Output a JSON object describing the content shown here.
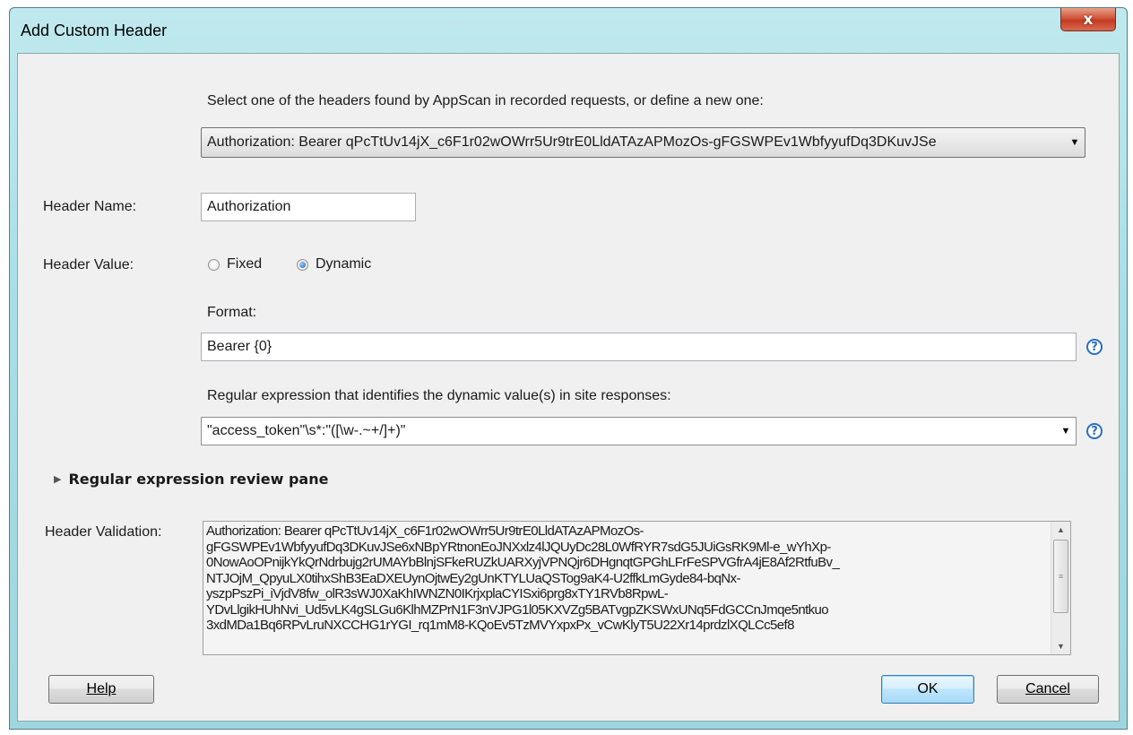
{
  "window": {
    "title": "Add Custom Header",
    "close_glyph": "x",
    "icons": {
      "close": "close-icon",
      "help": "question-mark-icon",
      "expander": "triangle-right-icon",
      "dropdown": "chevron-down-icon"
    }
  },
  "intro": "Select one of the headers found by AppScan in recorded requests, or define a new one:",
  "header_select": {
    "value": "Authorization: Bearer qPcTtUv14jX_c6F1r02wOWrr5Ur9trE0LldATAzAPMozOs-gFGSWPEv1WbfyyufDq3DKuvJSe",
    "arrow": "▼"
  },
  "header_name": {
    "label": "Header Name:",
    "value": "Authorization"
  },
  "header_value": {
    "label": "Header Value:",
    "options": [
      {
        "label": "Fixed",
        "selected": false
      },
      {
        "label": "Dynamic",
        "selected": true
      }
    ]
  },
  "format": {
    "label": "Format:",
    "value": "Bearer {0}"
  },
  "regex": {
    "label": "Regular expression that identifies the dynamic value(s) in site responses:",
    "value": "\"access_token\"\\s*:\"([\\w-.~+/]+)\"",
    "arrow": "▼"
  },
  "review_pane": {
    "label": "Regular expression review pane",
    "glyph": "▶"
  },
  "validation": {
    "label": "Header Validation:",
    "lines": [
      "Authorization: Bearer qPcTtUv14jX_c6F1r02wOWrr5Ur9trE0LldATAzAPMozOs-",
      "gFGSWPEv1WbfyyufDq3DKuvJSe6xNBpYRtnonEoJNXxlz4lJQUyDc28L0WfRYR7sdG5JUiGsRK9Ml-e_wYhXp-",
      "0NowAoOPnijkYkQrNdrbujg2rUMAYbBlnjSFkeRUZkUARXyjVPNQjr6DHgnqtGPGhLFrFeSPVGfrA4jE8Af2RtfuBv_",
      "NTJOjM_QpyuLX0tihxShB3EaDXEUynOjtwEy2gUnKTYLUaQSTog9aK4-U2ffkLmGyde84-bqNx-",
      "yszpPszPi_iVjdV8fw_olR3sWJ0XaKhIWNZN0IKrjxplaCYISxi6prg8xTY1RVb8RpwL-",
      "YDvLlgikHUhNvi_Ud5vLK4gSLGu6KlhMZPrN1F3nVJPG1l05KXVZg5BATvgpZKSWxUNq5FdGCCnJmqe5ntkuo",
      "3xdMDa1Bq6RPvLruNXCCHG1rYGI_rq1mM8-KQoEv5TzMVYxpxPx_vCwKlyT5U22Xr14prdzlXQLCc5ef8"
    ],
    "scroll_up": "▲",
    "scroll_down": "▼",
    "thumb_grip": "≡"
  },
  "buttons": {
    "help": "Help",
    "ok": "OK",
    "cancel": "Cancel"
  }
}
